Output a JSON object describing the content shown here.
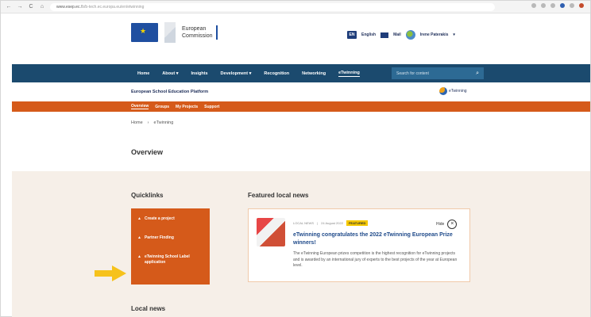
{
  "browser": {
    "url_host": "www.esep.ec.",
    "url_path": "fb/b-tech.ec.europa.eu/en/etwinning",
    "nav": [
      "←",
      "→",
      "C",
      "⌂"
    ]
  },
  "header": {
    "logo_line1": "European",
    "logo_line2": "Commission",
    "language_code": "EN",
    "language_label": "English",
    "mail_label": "Mail",
    "user_name": "Irene Paterakis",
    "user_caret": "▾"
  },
  "mainnav": {
    "items": [
      "Home",
      "About ▾",
      "Insights",
      "Development ▾",
      "Recognition",
      "Networking",
      "eTwinning"
    ],
    "search_placeholder": "Search for content",
    "search_icon": "⌕"
  },
  "platform": {
    "title": "European School Education Platform",
    "etwinning_logo_text": "eTwinning"
  },
  "subnav": {
    "items": [
      "Overview",
      "Groups",
      "My Projects",
      "Support"
    ]
  },
  "breadcrumb": {
    "home": "Home",
    "separator": "›",
    "current": "eTwinning"
  },
  "page": {
    "title": "Overview",
    "quicklinks_title": "Quicklinks",
    "featured_title": "Featured local news",
    "local_news_title": "Local news"
  },
  "quicklinks": [
    {
      "label": "Create a project"
    },
    {
      "label": "Partner Finding"
    },
    {
      "label": "eTwinning School Label application"
    }
  ],
  "news_card": {
    "category": "LOCAL NEWS",
    "divider": "|",
    "date": "24 August 2022",
    "badge": "FEATURED",
    "hide_label": "Hide",
    "close_glyph": "×",
    "headline": "eTwinning congratulates the 2022 eTwinning European Prize winners!",
    "description": "The eTwinning European prizes competition is the highest recognition for eTwinning projects and is awarded by an international jury of experts to the best projects of the year at European level."
  },
  "colors": {
    "nav_blue": "#1b4a6e",
    "accent_orange": "#d55a1a",
    "arrow_yellow": "#f6c21c"
  }
}
